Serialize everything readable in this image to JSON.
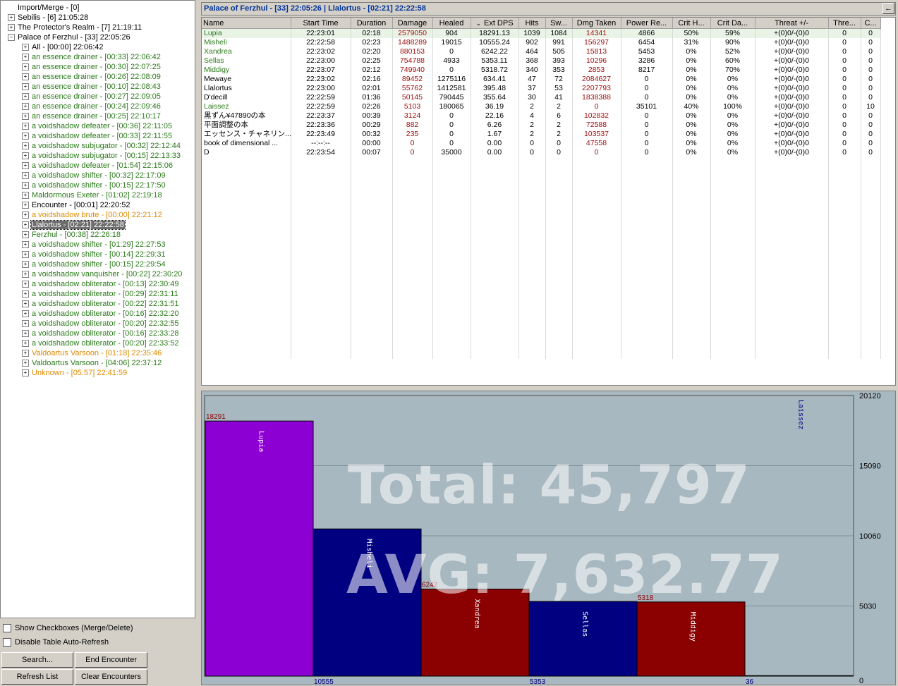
{
  "tree": [
    {
      "label": "Import/Merge - [0]",
      "color": "black",
      "depth": 0,
      "exp": "none"
    },
    {
      "label": "Sebilis - [6] 21:05:28",
      "color": "black",
      "depth": 0,
      "exp": "+"
    },
    {
      "label": "The Protector's Realm - [7] 21:19:11",
      "color": "black",
      "depth": 0,
      "exp": "+"
    },
    {
      "label": "Palace of Ferzhul - [33] 22:05:26",
      "color": "black",
      "depth": 0,
      "exp": "-"
    },
    {
      "label": "All - [00:00] 22:06:42",
      "color": "black",
      "depth": 1,
      "exp": "+"
    },
    {
      "label": "an essence drainer - [00:33] 22:06:42",
      "color": "green",
      "depth": 1,
      "exp": "+"
    },
    {
      "label": "an essence drainer - [00:30] 22:07:25",
      "color": "green",
      "depth": 1,
      "exp": "+"
    },
    {
      "label": "an essence drainer - [00:26] 22:08:09",
      "color": "green",
      "depth": 1,
      "exp": "+"
    },
    {
      "label": "an essence drainer - [00:10] 22:08:43",
      "color": "green",
      "depth": 1,
      "exp": "+"
    },
    {
      "label": "an essence drainer - [00:27] 22:09:05",
      "color": "green",
      "depth": 1,
      "exp": "+"
    },
    {
      "label": "an essence drainer - [00:24] 22:09:46",
      "color": "green",
      "depth": 1,
      "exp": "+"
    },
    {
      "label": "an essence drainer - [00:25] 22:10:17",
      "color": "green",
      "depth": 1,
      "exp": "+"
    },
    {
      "label": "a voidshadow defeater - [00:36] 22:11:05",
      "color": "green",
      "depth": 1,
      "exp": "+"
    },
    {
      "label": "a voidshadow defeater - [00:33] 22:11:55",
      "color": "green",
      "depth": 1,
      "exp": "+"
    },
    {
      "label": "a voidshadow subjugator - [00:32] 22:12:44",
      "color": "green",
      "depth": 1,
      "exp": "+"
    },
    {
      "label": "a voidshadow subjugator - [00:15] 22:13:33",
      "color": "green",
      "depth": 1,
      "exp": "+"
    },
    {
      "label": "a voidshadow defeater - [01:54] 22:15:06",
      "color": "green",
      "depth": 1,
      "exp": "+"
    },
    {
      "label": "a voidshadow shifter - [00:32] 22:17:09",
      "color": "green",
      "depth": 1,
      "exp": "+"
    },
    {
      "label": "a voidshadow shifter - [00:15] 22:17:50",
      "color": "green",
      "depth": 1,
      "exp": "+"
    },
    {
      "label": "Maldormous Exeter - [01:02] 22:19:18",
      "color": "green",
      "depth": 1,
      "exp": "+"
    },
    {
      "label": "Encounter - [00:01] 22:20:52",
      "color": "black",
      "depth": 1,
      "exp": "+"
    },
    {
      "label": "a voidshadow brute - [00:00] 22:21:12",
      "color": "orange",
      "depth": 1,
      "exp": "+"
    },
    {
      "label": "Llalortus - [02:21] 22:22:58",
      "color": "green",
      "depth": 1,
      "exp": "+",
      "selected": true
    },
    {
      "label": "Ferzhul - [00:38] 22:26:18",
      "color": "green",
      "depth": 1,
      "exp": "+"
    },
    {
      "label": "a voidshadow shifter - [01:29] 22:27:53",
      "color": "green",
      "depth": 1,
      "exp": "+"
    },
    {
      "label": "a voidshadow shifter - [00:14] 22:29:31",
      "color": "green",
      "depth": 1,
      "exp": "+"
    },
    {
      "label": "a voidshadow shifter - [00:15] 22:29:54",
      "color": "green",
      "depth": 1,
      "exp": "+"
    },
    {
      "label": "a voidshadow vanquisher - [00:22] 22:30:20",
      "color": "green",
      "depth": 1,
      "exp": "+"
    },
    {
      "label": "a voidshadow obliterator - [00:13] 22:30:49",
      "color": "green",
      "depth": 1,
      "exp": "+"
    },
    {
      "label": "a voidshadow obliterator - [00:29] 22:31:11",
      "color": "green",
      "depth": 1,
      "exp": "+"
    },
    {
      "label": "a voidshadow obliterator - [00:22] 22:31:51",
      "color": "green",
      "depth": 1,
      "exp": "+"
    },
    {
      "label": "a voidshadow obliterator - [00:16] 22:32:20",
      "color": "green",
      "depth": 1,
      "exp": "+"
    },
    {
      "label": "a voidshadow obliterator - [00:20] 22:32:55",
      "color": "green",
      "depth": 1,
      "exp": "+"
    },
    {
      "label": "a voidshadow obliterator - [00:16] 22:33:28",
      "color": "green",
      "depth": 1,
      "exp": "+"
    },
    {
      "label": "a voidshadow obliterator - [00:20] 22:33:52",
      "color": "green",
      "depth": 1,
      "exp": "+"
    },
    {
      "label": "Valdoartus Varsoon - [01:18] 22:35:46",
      "color": "orange",
      "depth": 1,
      "exp": "+"
    },
    {
      "label": "Valdoartus Varsoon - [04:06] 22:37:12",
      "color": "green",
      "depth": 1,
      "exp": "+"
    },
    {
      "label": "Unknown - [05:57] 22:41:59",
      "color": "orange",
      "depth": 1,
      "exp": "+"
    }
  ],
  "options": {
    "show_checkboxes": "Show Checkboxes (Merge/Delete)",
    "disable_refresh": "Disable Table Auto-Refresh"
  },
  "buttons": {
    "search": "Search...",
    "end_encounter": "End Encounter",
    "refresh_list": "Refresh List",
    "clear_encounters": "Clear Encounters"
  },
  "encounter_title": "Palace of Ferzhul - [33] 22:05:26 | Llalortus - [02:21] 22:22:58",
  "back_arrow": "←",
  "table": {
    "columns": [
      "Name",
      "Start Time",
      "Duration",
      "Damage",
      "Healed",
      "Ext DPS",
      "Hits",
      "Sw...",
      "Dmg Taken",
      "Power Re...",
      "Crit H...",
      "Crit Da...",
      "Threat +/-",
      "Thre...",
      "C..."
    ],
    "sort_indicator": "⌄",
    "rows": [
      [
        "Lupia",
        "22:23:01",
        "02:18",
        "2579050",
        "904",
        "18291.13",
        "1039",
        "1084",
        "14341",
        "4866",
        "50%",
        "59%",
        "+(0)0/-(0)0",
        "0",
        "0"
      ],
      [
        "Misheli",
        "22:22:58",
        "02:23",
        "1488289",
        "19015",
        "10555.24",
        "902",
        "991",
        "156297",
        "6454",
        "31%",
        "90%",
        "+(0)0/-(0)0",
        "0",
        "0"
      ],
      [
        "Xandrea",
        "22:23:02",
        "02:20",
        "880153",
        "0",
        "6242.22",
        "464",
        "505",
        "15813",
        "5453",
        "0%",
        "52%",
        "+(0)0/-(0)0",
        "0",
        "0"
      ],
      [
        "Sellas",
        "22:23:00",
        "02:25",
        "754788",
        "4933",
        "5353.11",
        "368",
        "393",
        "10296",
        "3286",
        "0%",
        "60%",
        "+(0)0/-(0)0",
        "0",
        "0"
      ],
      [
        "Middigy",
        "22:23:07",
        "02:12",
        "749940",
        "0",
        "5318.72",
        "340",
        "353",
        "2853",
        "8217",
        "0%",
        "70%",
        "+(0)0/-(0)0",
        "0",
        "0"
      ],
      [
        "Mewaye",
        "22:23:02",
        "02:16",
        "89452",
        "1275116",
        "634.41",
        "47",
        "72",
        "2084627",
        "0",
        "0%",
        "0%",
        "+(0)0/-(0)0",
        "0",
        "0"
      ],
      [
        "Llalortus",
        "22:23:00",
        "02:01",
        "55762",
        "1412581",
        "395.48",
        "37",
        "53",
        "2207793",
        "0",
        "0%",
        "0%",
        "+(0)0/-(0)0",
        "0",
        "0"
      ],
      [
        "D'decill",
        "22:22:59",
        "01:36",
        "50145",
        "790445",
        "355.64",
        "30",
        "41",
        "1838388",
        "0",
        "0%",
        "0%",
        "+(0)0/-(0)0",
        "0",
        "0"
      ],
      [
        "Laissez",
        "22:22:59",
        "02:26",
        "5103",
        "180065",
        "36.19",
        "2",
        "2",
        "0",
        "35101",
        "40%",
        "100%",
        "+(0)0/-(0)0",
        "0",
        "10"
      ],
      [
        "黒ずん¥47890の本",
        "22:23:37",
        "00:39",
        "3124",
        "0",
        "22.16",
        "4",
        "6",
        "102832",
        "0",
        "0%",
        "0%",
        "+(0)0/-(0)0",
        "0",
        "0"
      ],
      [
        "平面調整の本",
        "22:23:36",
        "00:29",
        "882",
        "0",
        "6.26",
        "2",
        "2",
        "72588",
        "0",
        "0%",
        "0%",
        "+(0)0/-(0)0",
        "0",
        "0"
      ],
      [
        "エッセンス・チャネリン...",
        "22:23:49",
        "00:32",
        "235",
        "0",
        "1.67",
        "2",
        "2",
        "103537",
        "0",
        "0%",
        "0%",
        "+(0)0/-(0)0",
        "0",
        "0"
      ],
      [
        "book of dimensional ...",
        "--:--:--",
        "00:00",
        "0",
        "0",
        "0.00",
        "0",
        "0",
        "47558",
        "0",
        "0%",
        "0%",
        "+(0)0/-(0)0",
        "0",
        "0"
      ],
      [
        "D",
        "22:23:54",
        "00:07",
        "0",
        "35000",
        "0.00",
        "0",
        "0",
        "0",
        "0",
        "0%",
        "0%",
        "+(0)0/-(0)0",
        "0",
        "0"
      ]
    ],
    "green_names": [
      0,
      1,
      2,
      3,
      4,
      8
    ],
    "red_cols": [
      3,
      8
    ]
  },
  "chart_data": {
    "type": "bar",
    "categories": [
      "Lupia",
      "Misheli",
      "Xandrea",
      "Sellas",
      "Middigy",
      "Laissez"
    ],
    "values": [
      18291.13,
      10555.24,
      6242.22,
      5353.11,
      5318.72,
      36.19
    ],
    "top_labels": [
      "18291",
      "",
      "6242",
      "",
      "5318",
      ""
    ],
    "bottom_labels": [
      "",
      "10555",
      "",
      "5353",
      "",
      "36"
    ],
    "colors": [
      "#8c00d4",
      "#000080",
      "#8b0000",
      "#000080",
      "#8b0000",
      "#000080"
    ],
    "ylim": [
      0,
      20120
    ],
    "yticks": [
      0,
      5030,
      10060,
      15090,
      20120
    ],
    "total_text": "Total: 45,797",
    "avg_text": "AVG: 7,632.77",
    "background": "#a8b8c0"
  }
}
